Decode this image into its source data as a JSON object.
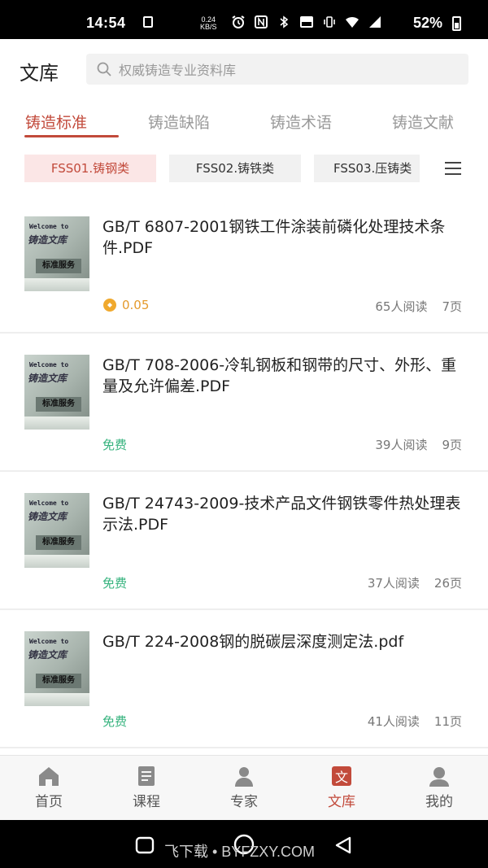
{
  "status_bar": {
    "time": "14:54",
    "net_speed_value": "0.24",
    "net_speed_unit": "KB/S",
    "battery": "52%"
  },
  "header": {
    "title": "文库",
    "search_placeholder": "权威铸造专业资料库"
  },
  "tabs": [
    {
      "label": "铸造标准",
      "active": true
    },
    {
      "label": "铸造缺陷",
      "active": false
    },
    {
      "label": "铸造术语",
      "active": false
    },
    {
      "label": "铸造文献",
      "active": false
    }
  ],
  "chips": [
    {
      "label": "FSS01.铸钢类",
      "active": true
    },
    {
      "label": "FSS02.铸铁类",
      "active": false
    },
    {
      "label": "FSS03.压铸类",
      "active": false
    }
  ],
  "thumbnail": {
    "line1": "Welcome to",
    "line2": "铸造文库",
    "line3": "标准服务"
  },
  "documents": [
    {
      "title": "GB/T 6807-2001钢铁工件涂装前磷化处理技术条件.PDF",
      "price": "0.05",
      "free": false,
      "reads": "65人阅读",
      "pages": "7页"
    },
    {
      "title": "GB/T 708-2006-冷轧钢板和钢带的尺寸、外形、重量及允许偏差.PDF",
      "price": "免费",
      "free": true,
      "reads": "39人阅读",
      "pages": "9页"
    },
    {
      "title": "GB/T 24743-2009-技术产品文件钢铁零件热处理表示法.PDF",
      "price": "免费",
      "free": true,
      "reads": "37人阅读",
      "pages": "26页"
    },
    {
      "title": "GB/T 224-2008钢的脱碳层深度测定法.pdf",
      "price": "免费",
      "free": true,
      "reads": "41人阅读",
      "pages": "11页"
    }
  ],
  "bottom_nav": [
    {
      "label": "首页",
      "icon": "home-icon",
      "active": false
    },
    {
      "label": "课程",
      "icon": "course-icon",
      "active": false
    },
    {
      "label": "专家",
      "icon": "expert-icon",
      "active": false
    },
    {
      "label": "文库",
      "icon": "library-icon",
      "active": true
    },
    {
      "label": "我的",
      "icon": "profile-icon",
      "active": false
    }
  ],
  "watermark": "飞下载 • BYFZXY.COM",
  "colors": {
    "accent": "#c24a3b",
    "free_green": "#36b37e",
    "price_orange": "#e49a2c"
  }
}
